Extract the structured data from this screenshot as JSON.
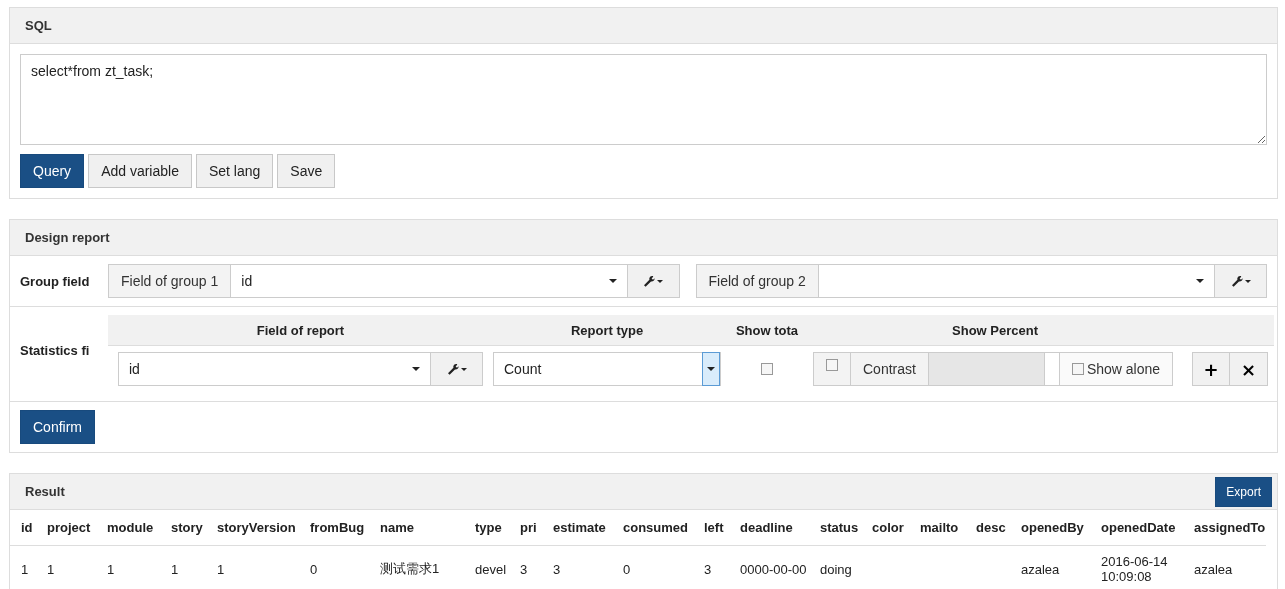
{
  "sql_panel": {
    "title": "SQL",
    "query": "select*from zt_task;",
    "buttons": [
      {
        "label": "Query",
        "kind": "primary"
      },
      {
        "label": "Add variable",
        "kind": "default"
      },
      {
        "label": "Set lang",
        "kind": "default"
      },
      {
        "label": "Save",
        "kind": "default"
      }
    ]
  },
  "design_panel": {
    "title": "Design report",
    "group_label": "Group field",
    "groups": [
      {
        "label": "Field of group 1",
        "value": "id"
      },
      {
        "label": "Field of group 2"
      }
    ],
    "stats_label": "Statistics fi",
    "columns": [
      "Field of report",
      "Report type",
      "Show tota",
      "Show Percent"
    ],
    "stat_row": {
      "field": "id",
      "report_type": "Count",
      "show_total": false,
      "percent_checked": false,
      "contrast_label": "Contrast",
      "show_alone_label": "Show alone",
      "show_alone": false,
      "add": "+",
      "remove": "×"
    },
    "confirm": "Confirm"
  },
  "result_panel": {
    "title": "Result",
    "export": "Export",
    "columns": [
      "id",
      "project",
      "module",
      "story",
      "storyVersion",
      "fromBug",
      "name",
      "type",
      "pri",
      "estimate",
      "consumed",
      "left",
      "deadline",
      "status",
      "color",
      "mailto",
      "desc",
      "openedBy",
      "openedDate",
      "assignedTo"
    ],
    "rows": [
      [
        "1",
        "1",
        "1",
        "1",
        "1",
        "0",
        "测试需求1",
        "devel",
        "3",
        "3",
        "0",
        "3",
        "0000-00-00",
        "doing",
        "",
        "",
        "",
        "azalea",
        "2016-06-14 10:09:08",
        "azalea"
      ]
    ]
  }
}
